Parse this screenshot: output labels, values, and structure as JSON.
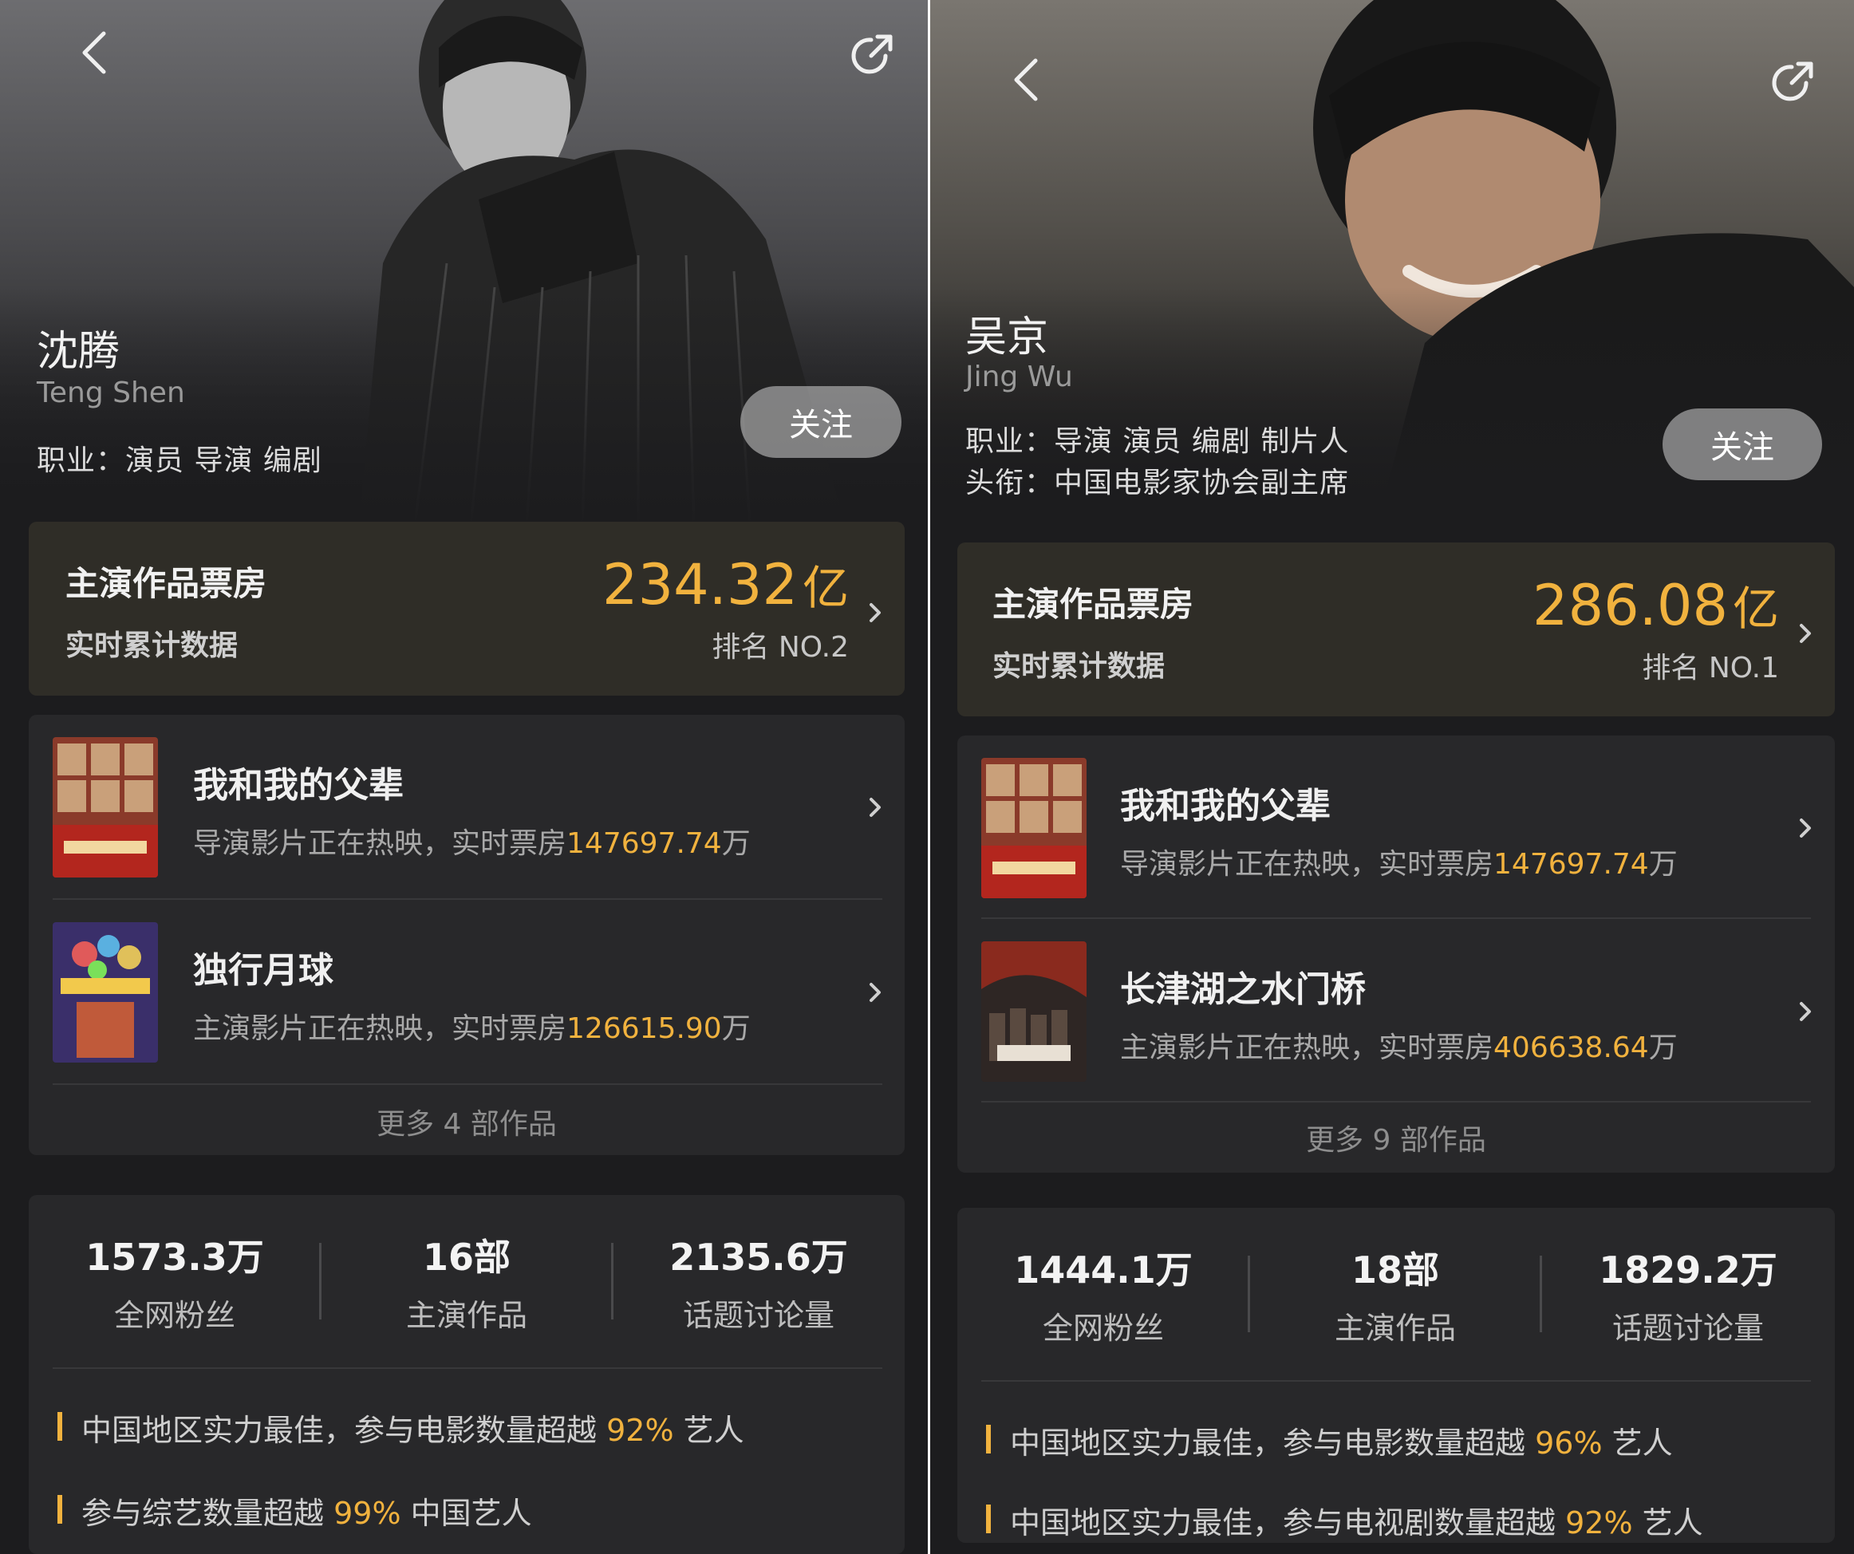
{
  "panels": [
    {
      "name_cn": "沈腾",
      "name_en": "Teng Shen",
      "occupation": "职业：演员 导演 编剧",
      "title_line": "",
      "follow_label": "关注",
      "box_office": {
        "title": "主演作品票房",
        "subtitle": "实时累计数据",
        "value": "234.32",
        "unit": "亿",
        "rank": "排名 NO.2"
      },
      "films": [
        {
          "title": "我和我的父辈",
          "prefix": "导演影片正在热映，实时票房",
          "amount": "147697.74",
          "suffix": "万"
        },
        {
          "title": "独行月球",
          "prefix": "主演影片正在热映，实时票房",
          "amount": "126615.90",
          "suffix": "万"
        }
      ],
      "more_label": "更多 4 部作品",
      "stats": [
        {
          "value": "1573.3万",
          "label": "全网粉丝"
        },
        {
          "value": "16部",
          "label": "主演作品"
        },
        {
          "value": "2135.6万",
          "label": "话题讨论量"
        }
      ],
      "achievements": [
        {
          "prefix": "中国地区实力最佳，参与电影数量超越",
          "pct": "92%",
          "suffix": "艺人"
        },
        {
          "prefix": "参与综艺数量超越",
          "pct": "99%",
          "suffix": "中国艺人"
        }
      ]
    },
    {
      "name_cn": "吴京",
      "name_en": "Jing Wu",
      "occupation": "职业：导演 演员 编剧 制片人",
      "title_line": "头衔：中国电影家协会副主席",
      "follow_label": "关注",
      "box_office": {
        "title": "主演作品票房",
        "subtitle": "实时累计数据",
        "value": "286.08",
        "unit": "亿",
        "rank": "排名 NO.1"
      },
      "films": [
        {
          "title": "我和我的父辈",
          "prefix": "导演影片正在热映，实时票房",
          "amount": "147697.74",
          "suffix": "万"
        },
        {
          "title": "长津湖之水门桥",
          "prefix": "主演影片正在热映，实时票房",
          "amount": "406638.64",
          "suffix": "万"
        }
      ],
      "more_label": "更多 9 部作品",
      "stats": [
        {
          "value": "1444.1万",
          "label": "全网粉丝"
        },
        {
          "value": "18部",
          "label": "主演作品"
        },
        {
          "value": "1829.2万",
          "label": "话题讨论量"
        }
      ],
      "achievements": [
        {
          "prefix": "中国地区实力最佳，参与电影数量超越",
          "pct": "96%",
          "suffix": "艺人"
        },
        {
          "prefix": "中国地区实力最佳，参与电视剧数量超越",
          "pct": "92%",
          "suffix": "艺人"
        }
      ]
    }
  ],
  "colors": {
    "accent": "#f1b23e",
    "background": "#1c1c1e",
    "card": "#28282a",
    "box_card": "#2f2d27"
  },
  "icons": [
    "back-arrow-icon",
    "share-icon",
    "chevron-right-icon"
  ]
}
